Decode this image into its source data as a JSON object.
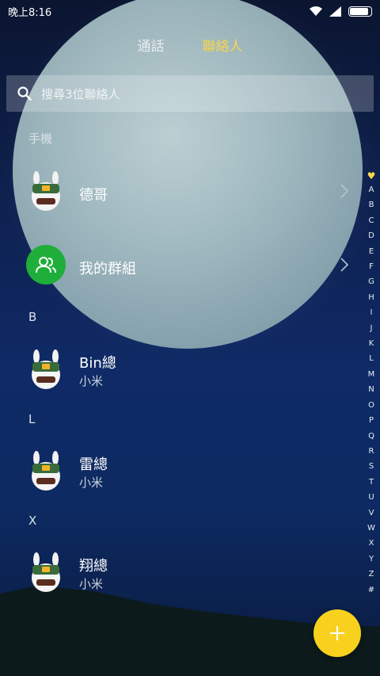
{
  "status_bar": {
    "time": "晚上8:16"
  },
  "tabs": [
    {
      "label": "通話",
      "active": false
    },
    {
      "label": "聯絡人",
      "active": true
    }
  ],
  "search": {
    "placeholder": "搜尋3位聯絡人"
  },
  "sections": {
    "phone": "手機",
    "b": "B",
    "l": "L",
    "x": "X"
  },
  "contacts": {
    "dege": {
      "name": "德哥"
    },
    "group": {
      "name": "我的群組"
    },
    "bin": {
      "name": "Bin總",
      "subtitle": "小米"
    },
    "lei": {
      "name": "雷總",
      "subtitle": "小米"
    },
    "xiang": {
      "name": "翔總",
      "subtitle": "小米"
    }
  },
  "alphabet_index": {
    "favorites_icon": "heart-icon",
    "letters": [
      "A",
      "B",
      "C",
      "D",
      "E",
      "F",
      "G",
      "H",
      "I",
      "J",
      "K",
      "L",
      "M",
      "N",
      "O",
      "P",
      "Q",
      "R",
      "S",
      "T",
      "U",
      "V",
      "W",
      "X",
      "Y",
      "Z",
      "#"
    ]
  },
  "colors": {
    "active_tab": "#f7d64a",
    "fab": "#f7d11e",
    "group_avatar": "#1fae3a"
  },
  "fab": {
    "icon": "plus-icon"
  }
}
